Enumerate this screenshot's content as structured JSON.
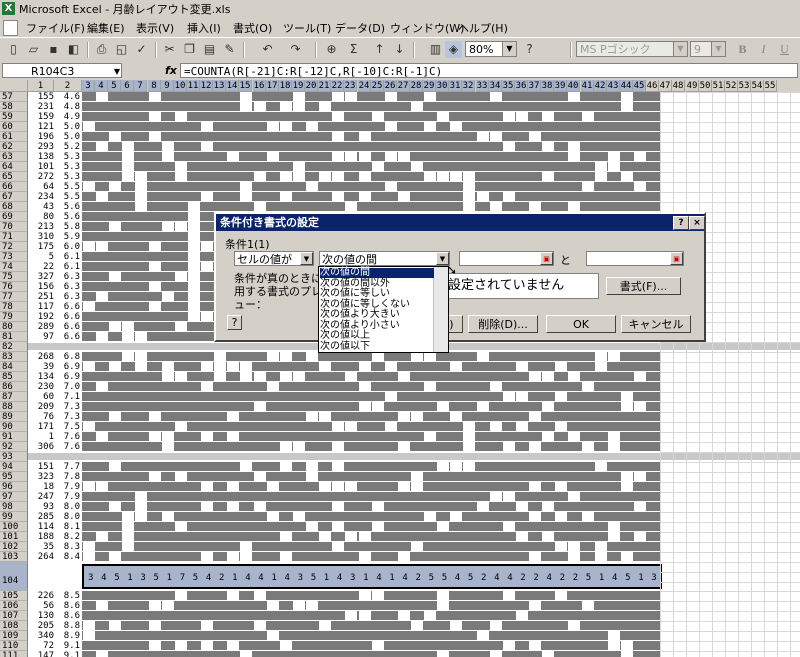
{
  "window": {
    "title": "Microsoft Excel - 月齢レイアウト変更.xls"
  },
  "menu": [
    "ファイル(F)",
    "編集(E)",
    "表示(V)",
    "挿入(I)",
    "書式(O)",
    "ツール(T)",
    "データ(D)",
    "ウィンドウ(W)",
    "ヘルプ(H)"
  ],
  "toolbar": {
    "zoom": "80%",
    "font": "MS Pゴシック",
    "size": "9",
    "bold": "B",
    "italic": "I",
    "underline": "U"
  },
  "formula_bar": {
    "name_box": "R104C3",
    "fx": "fx",
    "formula": "=COUNTA(R[-21]C:R[-12]C,R[-10]C:R[-1]C)"
  },
  "column_headers": [
    "1",
    "2",
    "3",
    "4",
    "5",
    "6",
    "7",
    "8",
    "9",
    "10",
    "11",
    "12",
    "13",
    "14",
    "15",
    "16",
    "17",
    "18",
    "19",
    "20",
    "21",
    "22",
    "23",
    "24",
    "25",
    "26",
    "27",
    "28",
    "29",
    "30",
    "31",
    "32",
    "33",
    "34",
    "35",
    "36",
    "37",
    "38",
    "39",
    "40",
    "41",
    "42",
    "43",
    "44",
    "45",
    "46",
    "47",
    "48",
    "49",
    "50",
    "51",
    "52",
    "53",
    "54",
    "55"
  ],
  "rows": [
    {
      "n": "57",
      "a": "155",
      "b": "4.6"
    },
    {
      "n": "58",
      "a": "231",
      "b": "4.8"
    },
    {
      "n": "59",
      "a": "159",
      "b": "4.9"
    },
    {
      "n": "60",
      "a": "121",
      "b": "5.0"
    },
    {
      "n": "61",
      "a": "196",
      "b": "5.0"
    },
    {
      "n": "62",
      "a": "293",
      "b": "5.2"
    },
    {
      "n": "63",
      "a": "138",
      "b": "5.3"
    },
    {
      "n": "64",
      "a": "101",
      "b": "5.3"
    },
    {
      "n": "65",
      "a": "272",
      "b": "5.3"
    },
    {
      "n": "66",
      "a": "64",
      "b": "5.5"
    },
    {
      "n": "67",
      "a": "234",
      "b": "5.5"
    },
    {
      "n": "68",
      "a": "43",
      "b": "5.6"
    },
    {
      "n": "69",
      "a": "80",
      "b": "5.6"
    },
    {
      "n": "70",
      "a": "213",
      "b": "5.8"
    },
    {
      "n": "71",
      "a": "310",
      "b": "5.9"
    },
    {
      "n": "72",
      "a": "175",
      "b": "6.0"
    },
    {
      "n": "73",
      "a": "5",
      "b": "6.1"
    },
    {
      "n": "74",
      "a": "22",
      "b": "6.1"
    },
    {
      "n": "75",
      "a": "327",
      "b": "6.3"
    },
    {
      "n": "76",
      "a": "156",
      "b": "6.3"
    },
    {
      "n": "77",
      "a": "251",
      "b": "6.3"
    },
    {
      "n": "78",
      "a": "117",
      "b": "6.6"
    },
    {
      "n": "79",
      "a": "192",
      "b": "6.6"
    },
    {
      "n": "80",
      "a": "289",
      "b": "6.6"
    },
    {
      "n": "81",
      "a": "97",
      "b": "6.6"
    },
    {
      "n": "82",
      "a": "",
      "b": ""
    },
    {
      "n": "83",
      "a": "268",
      "b": "6.8"
    },
    {
      "n": "84",
      "a": "39",
      "b": "6.9"
    },
    {
      "n": "85",
      "a": "134",
      "b": "6.9"
    },
    {
      "n": "86",
      "a": "230",
      "b": "7.0"
    },
    {
      "n": "87",
      "a": "60",
      "b": "7.1"
    },
    {
      "n": "88",
      "a": "209",
      "b": "7.3"
    },
    {
      "n": "89",
      "a": "76",
      "b": "7.3"
    },
    {
      "n": "90",
      "a": "171",
      "b": "7.5"
    },
    {
      "n": "91",
      "a": "1",
      "b": "7.6"
    },
    {
      "n": "92",
      "a": "306",
      "b": "7.6"
    },
    {
      "n": "93",
      "a": "",
      "b": ""
    },
    {
      "n": "94",
      "a": "151",
      "b": "7.7"
    },
    {
      "n": "95",
      "a": "323",
      "b": "7.8"
    },
    {
      "n": "96",
      "a": "18",
      "b": "7.9"
    },
    {
      "n": "97",
      "a": "247",
      "b": "7.9"
    },
    {
      "n": "98",
      "a": "93",
      "b": "8.0"
    },
    {
      "n": "99",
      "a": "285",
      "b": "8.0"
    },
    {
      "n": "100",
      "a": "114",
      "b": "8.1"
    },
    {
      "n": "101",
      "a": "188",
      "b": "8.2"
    },
    {
      "n": "102",
      "a": "35",
      "b": "8.3"
    },
    {
      "n": "103",
      "a": "264",
      "b": "8.4"
    },
    {
      "n": "104",
      "a": "",
      "b": ""
    },
    {
      "n": "105",
      "a": "226",
      "b": "8.5"
    },
    {
      "n": "106",
      "a": "56",
      "b": "8.6"
    },
    {
      "n": "107",
      "a": "130",
      "b": "8.6"
    },
    {
      "n": "108",
      "a": "205",
      "b": "8.8"
    },
    {
      "n": "109",
      "a": "340",
      "b": "8.9"
    },
    {
      "n": "110",
      "a": "72",
      "b": "9.1"
    },
    {
      "n": "111",
      "a": "147",
      "b": "9.1"
    },
    {
      "n": "112",
      "a": "302",
      "b": "9.2"
    }
  ],
  "row104_values": [
    "3",
    "4",
    "5",
    "1",
    "3",
    "5",
    "1",
    "7",
    "5",
    "4",
    "2",
    "1",
    "4",
    "4",
    "1",
    "4",
    "3",
    "5",
    "1",
    "4",
    "3",
    "1",
    "4",
    "1",
    "4",
    "2",
    "5",
    "5",
    "4",
    "5",
    "2",
    "4",
    "4",
    "2",
    "2",
    "4",
    "2",
    "2",
    "5",
    "1",
    "4",
    "5",
    "1",
    "3"
  ],
  "dialog": {
    "title": "条件付き書式の設定",
    "help_button": "?",
    "close_button": "×",
    "condition_label": "条件1(1)",
    "type_value": "セルの値が",
    "operator_value": "次の値の間",
    "and_label": "と",
    "preview_label": "条件が真のときに使用する書式のプレビュー：",
    "preview_text": "設定されていません",
    "format_button": "書式(F)...",
    "add_button": "追加(A) >>",
    "delete_button": "削除(D)...",
    "ok_button": "OK",
    "cancel_button": "キャンセル",
    "operator_options": [
      "次の値の間",
      "次の値の間以外",
      "次の値に等しい",
      "次の値に等しくない",
      "次の値より大きい",
      "次の値より小さい",
      "次の値以上",
      "次の値以下"
    ]
  }
}
